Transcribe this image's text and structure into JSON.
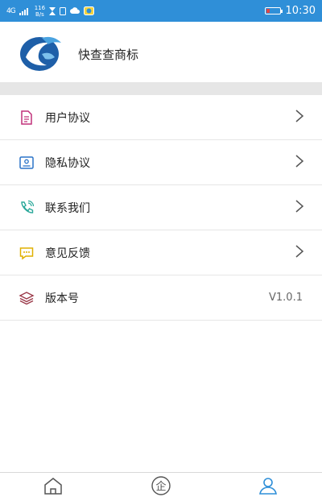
{
  "status_bar": {
    "signal": "4G",
    "net_speed_value": "116",
    "net_speed_unit": "B/s",
    "time": "10:30"
  },
  "header": {
    "app_name": "快查查商标"
  },
  "menu": {
    "items": [
      {
        "label": "用户协议",
        "icon": "document-icon",
        "icon_color": "#c0307a"
      },
      {
        "label": "隐私协议",
        "icon": "id-card-icon",
        "icon_color": "#2b74c8"
      },
      {
        "label": "联系我们",
        "icon": "phone-icon",
        "icon_color": "#2aa89a"
      },
      {
        "label": "意见反馈",
        "icon": "message-icon",
        "icon_color": "#e0b000"
      }
    ],
    "version": {
      "label": "版本号",
      "value": "V1.0.1",
      "icon": "layers-icon",
      "icon_color": "#9b3a4a"
    }
  },
  "tabbar": {
    "tabs": [
      {
        "icon": "home-icon",
        "icon_text": ""
      },
      {
        "icon": "company-icon",
        "icon_text": "企"
      },
      {
        "icon": "user-icon",
        "icon_text": "",
        "active": true
      }
    ],
    "active_color": "#2f8fd8"
  }
}
